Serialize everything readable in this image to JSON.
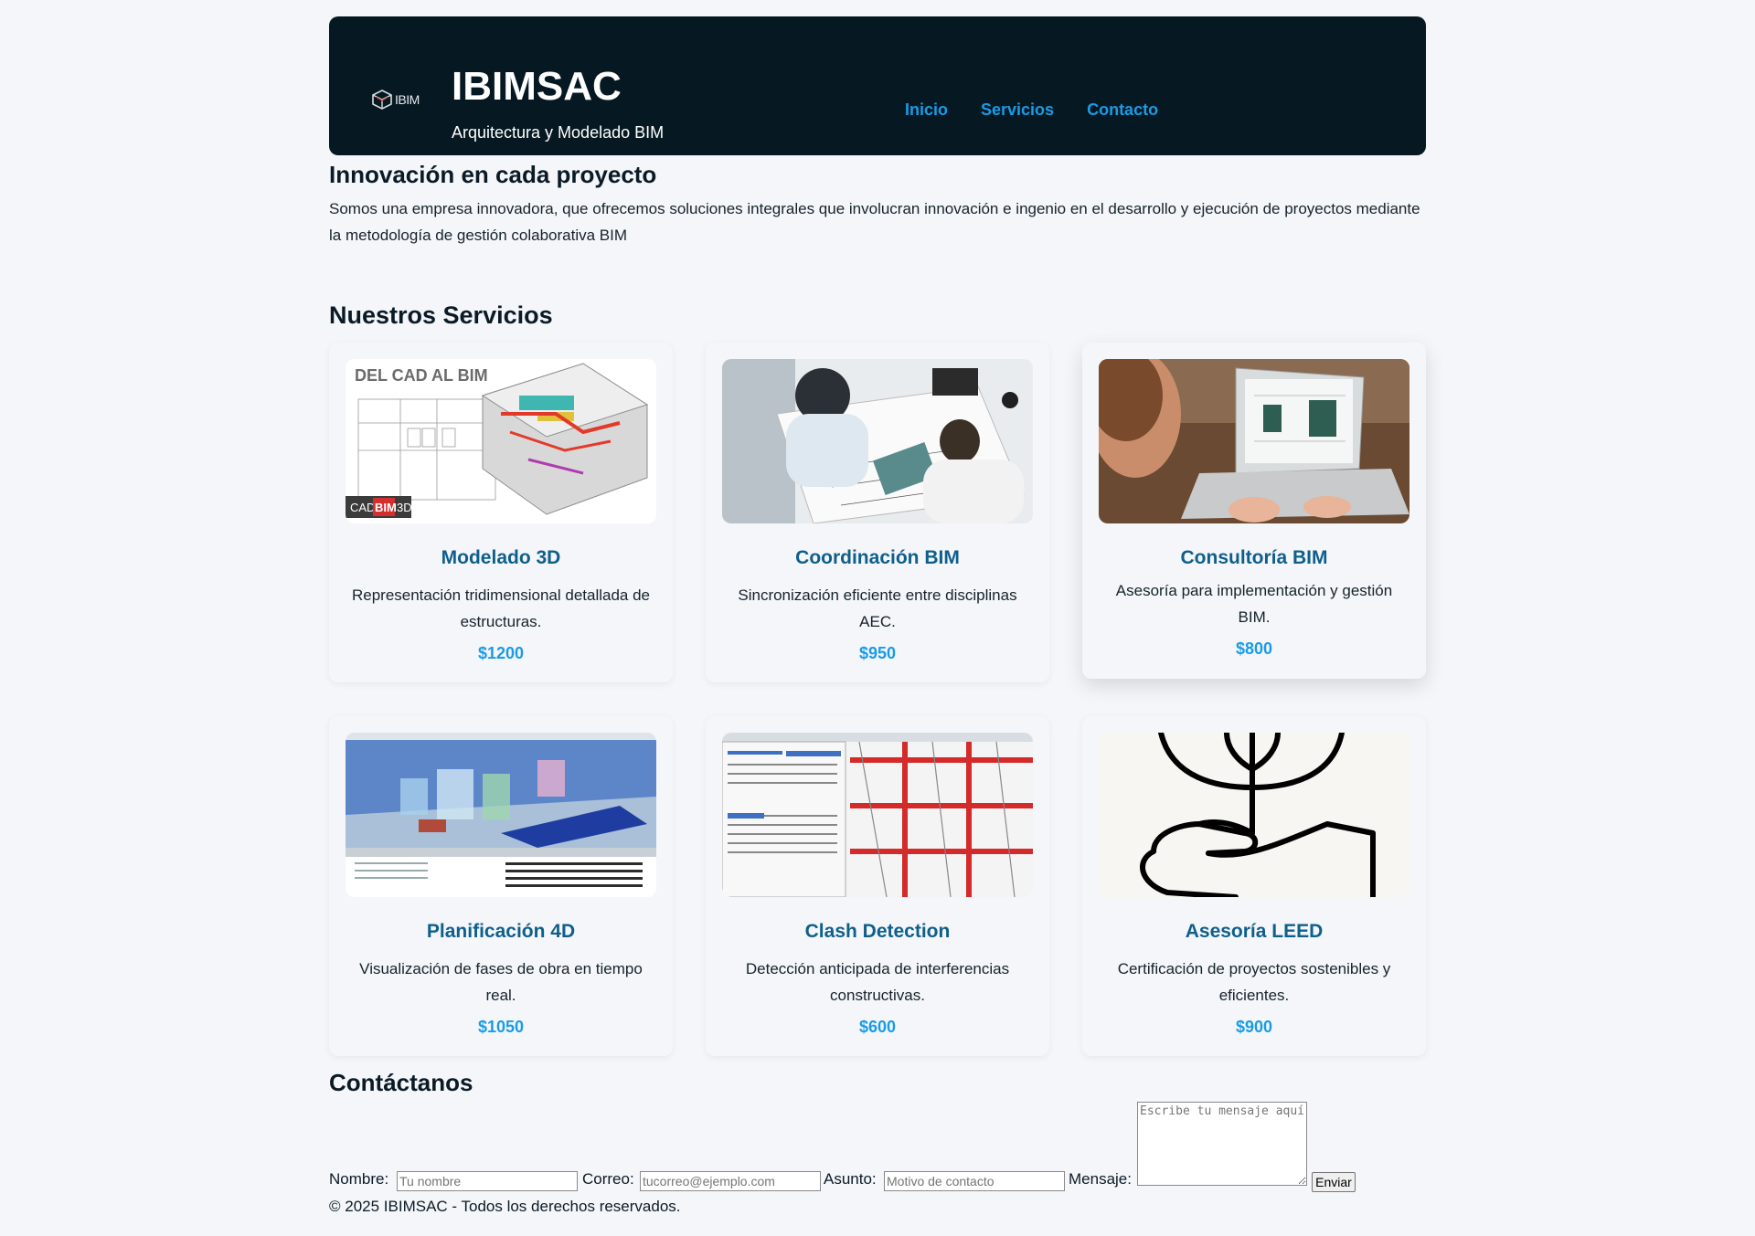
{
  "header": {
    "logo_text": "IBIM",
    "brand": "IBIMSAC",
    "tagline": "Arquitectura y Modelado BIM",
    "nav": [
      {
        "label": "Inicio"
      },
      {
        "label": "Servicios"
      },
      {
        "label": "Contacto"
      }
    ]
  },
  "intro": {
    "title": "Innovación en cada proyecto",
    "text": "Somos una empresa innovadora, que ofrecemos soluciones integrales que involucran innovación e ingenio en el desarrollo y ejecución de proyectos mediante la metodología de gestión colaborativa BIM"
  },
  "services": {
    "title": "Nuestros Servicios",
    "items": [
      {
        "title": "Modelado 3D",
        "desc": "Representación tridimensional detallada de estructuras.",
        "price": "$1200",
        "image_label": "DEL CAD AL BIM",
        "image_badge_a": "CAD",
        "image_badge_b": "BIM",
        "image_badge_c": "3D"
      },
      {
        "title": "Coordinación BIM",
        "desc": "Sincronización eficiente entre disciplinas AEC.",
        "price": "$950"
      },
      {
        "title": "Consultoría BIM",
        "desc": "Asesoría para implementación y gestión BIM.",
        "price": "$800"
      },
      {
        "title": "Planificación 4D",
        "desc": "Visualización de fases de obra en tiempo real.",
        "price": "$1050"
      },
      {
        "title": "Clash Detection",
        "desc": "Detección anticipada de interferencias constructivas.",
        "price": "$600"
      },
      {
        "title": "Asesoría LEED",
        "desc": "Certificación de proyectos sostenibles y eficientes.",
        "price": "$900"
      }
    ]
  },
  "contact": {
    "title": "Contáctanos",
    "name_label": "Nombre:",
    "name_placeholder": "Tu nombre",
    "email_label": "Correo:",
    "email_placeholder": "tucorreo@ejemplo.com",
    "subject_label": "Asunto:",
    "subject_placeholder": "Motivo de contacto",
    "message_label": "Mensaje:",
    "message_placeholder": "Escribe tu mensaje aquí",
    "submit_label": "Enviar"
  },
  "footer": {
    "text": "© 2025 IBIMSAC - Todos los derechos reservados."
  },
  "colors": {
    "header_bg": "#061922",
    "nav_link": "#1a9be6",
    "card_title": "#0f5f8c",
    "price": "#1a9be6",
    "page_bg": "#f4f6f9"
  }
}
